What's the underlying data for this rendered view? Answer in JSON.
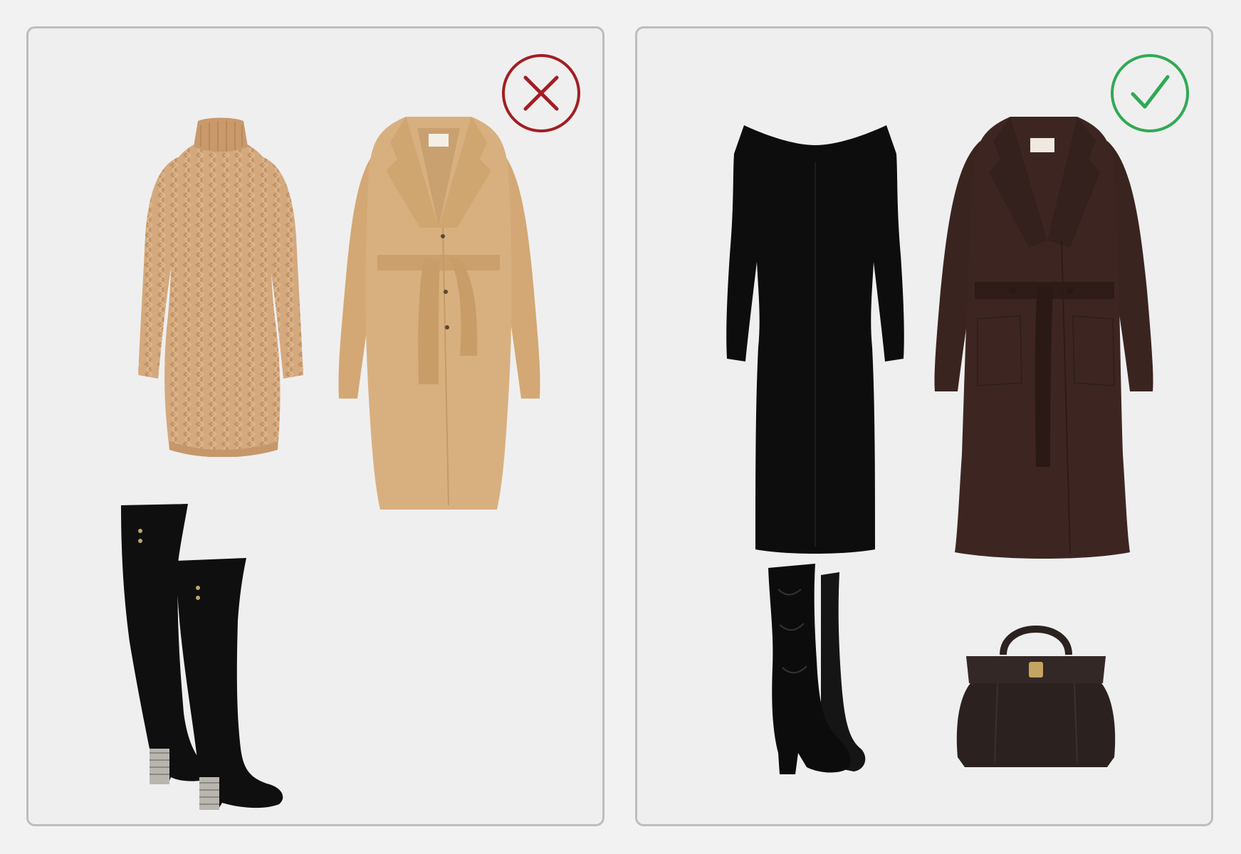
{
  "panels": [
    {
      "verdict": "incorrect",
      "mark_icon": "x-circle-icon",
      "mark_color": "#a31d22",
      "items": [
        "cable-knit-sweater-dress",
        "camel-belted-coat",
        "over-the-knee-suede-boots"
      ]
    },
    {
      "verdict": "correct",
      "mark_icon": "check-circle-icon",
      "mark_color": "#2faa55",
      "items": [
        "black-off-shoulder-midi-dress",
        "brown-belted-wrap-coat",
        "black-leather-knee-boots",
        "dark-brown-leather-handbag"
      ]
    }
  ],
  "colors": {
    "camel": "#d5ab7f",
    "coat_camel": "#d8b07f",
    "black": "#0d0d0d",
    "brown_coat": "#3a2420",
    "bag_brown": "#2b2220"
  }
}
